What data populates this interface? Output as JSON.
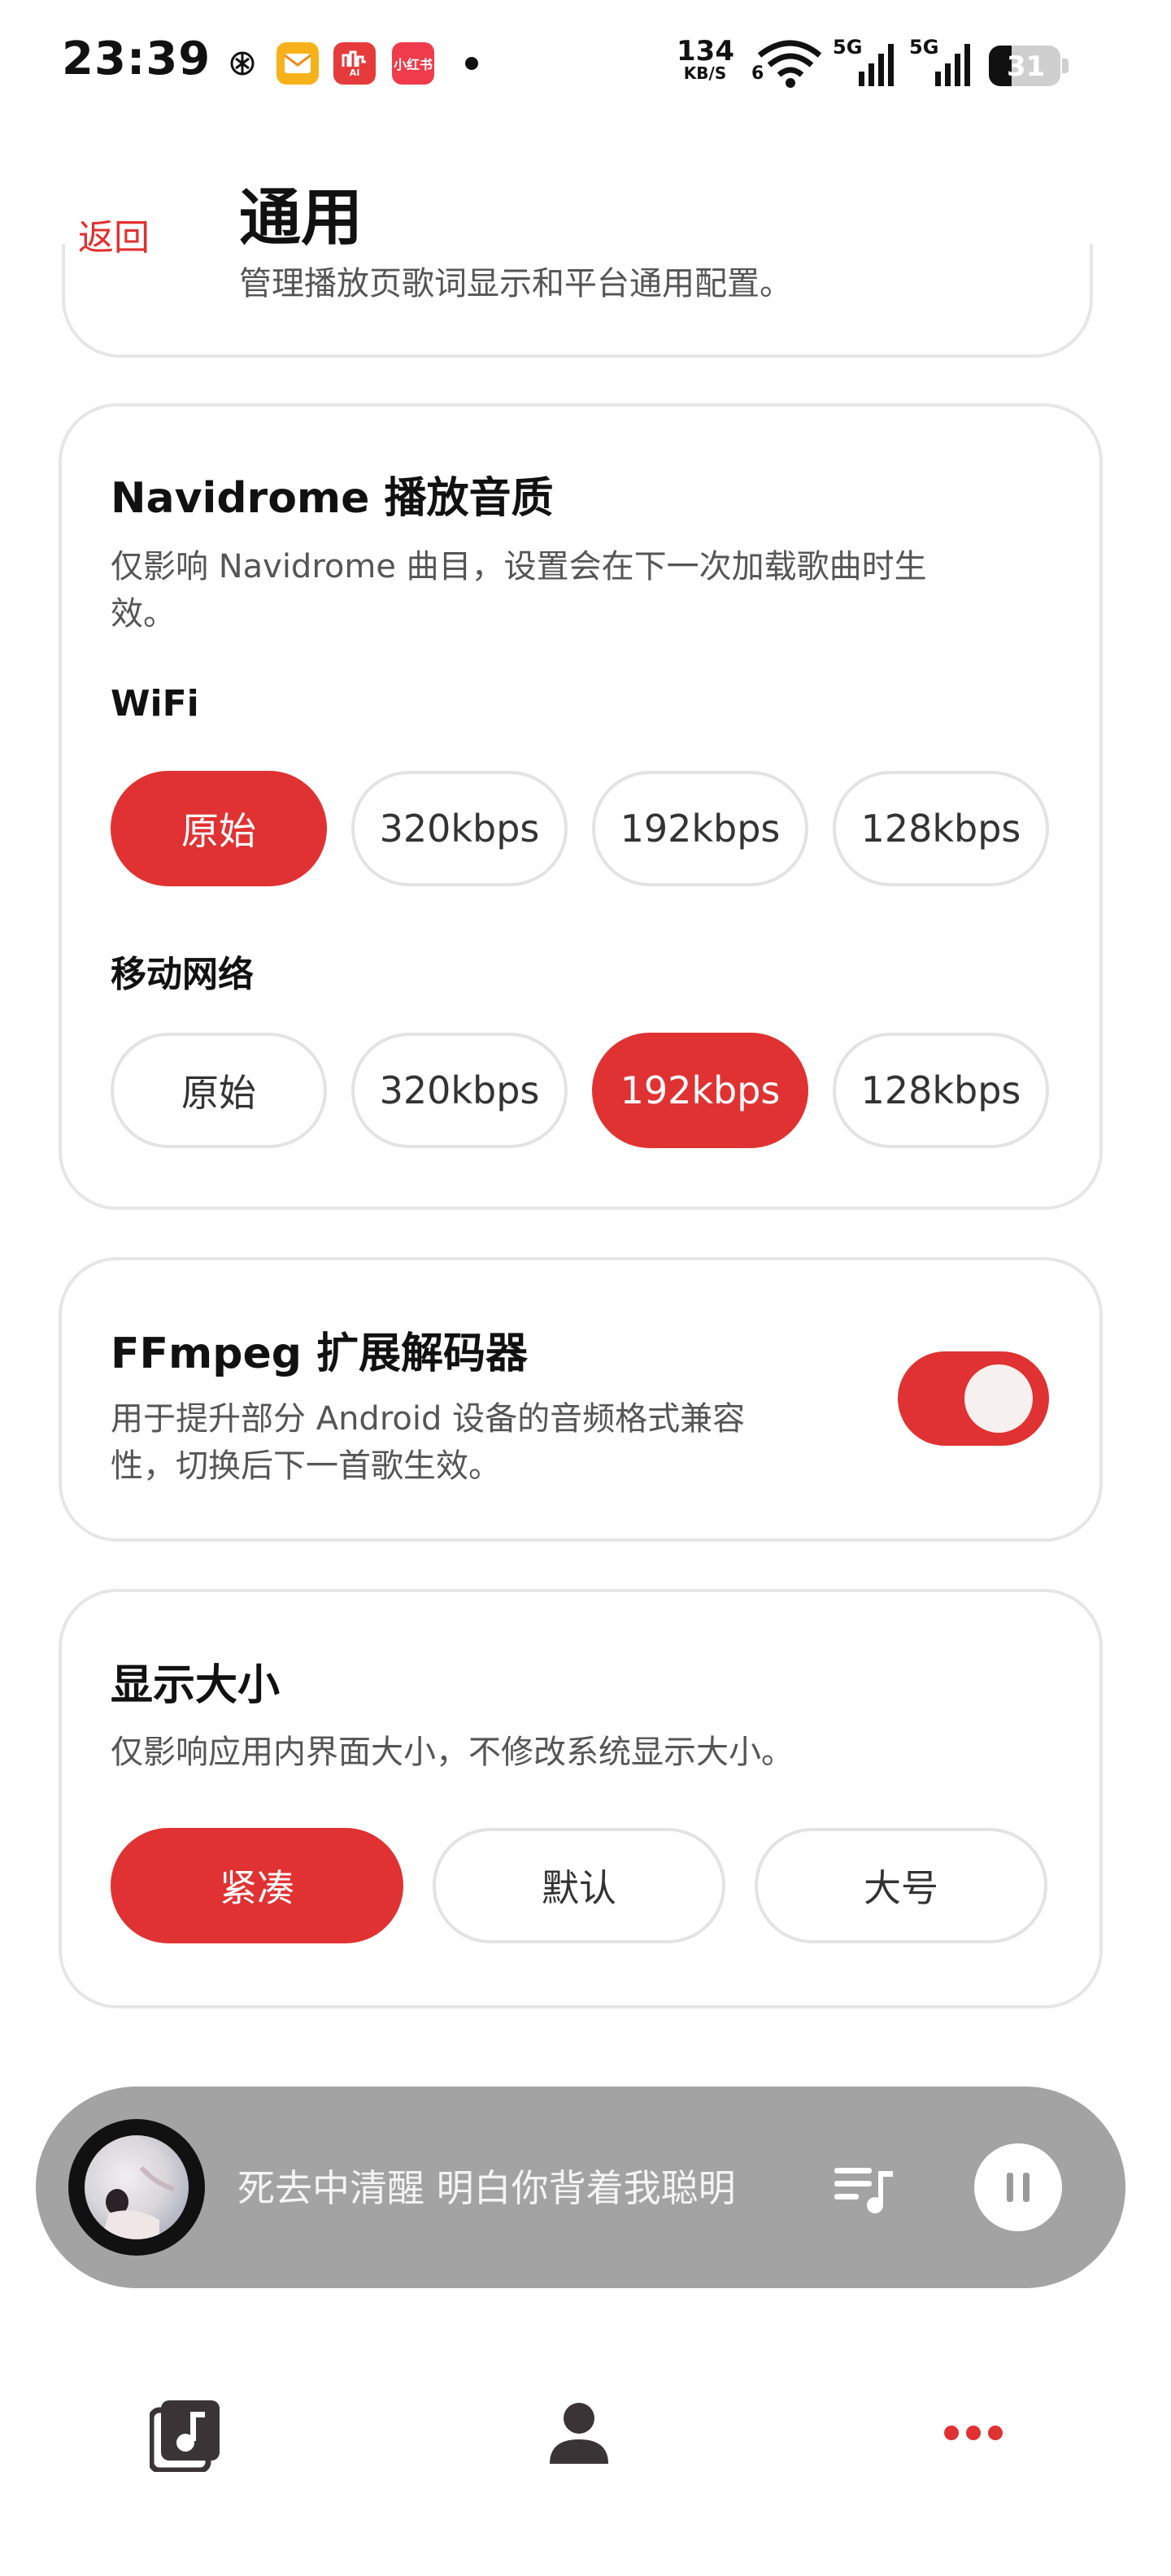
{
  "status_bar": {
    "time": "23:39",
    "app_icons": [
      "chatgpt-icon",
      "mail-app-icon",
      "ai-app-icon",
      "xiaohongshu-icon"
    ],
    "xiaohongshu_label": "小红书",
    "ai_label": "AI",
    "net_speed_value": "134",
    "net_speed_unit": "KB/S",
    "wifi_label": "6",
    "signal1_label": "5G",
    "signal2_label": "5G",
    "battery": "31",
    "colors": {
      "mail": "#f7b21b",
      "ai": "#e53b3b",
      "xhs": "#ef3b4a"
    }
  },
  "header": {
    "back_label": "返回",
    "title": "通用",
    "subtitle": "管理播放页歌词显示和平台通用配置。"
  },
  "quality": {
    "title": "Navidrome 播放音质",
    "description_line1": "仅影响 Navidrome 曲目，设置会在下一次加载歌曲时生",
    "description_line2": "效。",
    "wifi_label": "WiFi",
    "wifi_options": [
      "原始",
      "320kbps",
      "192kbps",
      "128kbps"
    ],
    "wifi_selected": "原始",
    "mobile_label": "移动网络",
    "mobile_options": [
      "原始",
      "320kbps",
      "192kbps",
      "128kbps"
    ],
    "mobile_selected": "192kbps"
  },
  "ffmpeg": {
    "title": "FFmpeg 扩展解码器",
    "description_line1": "用于提升部分 Android 设备的音频格式兼容",
    "description_line2": "性，切换后下一首歌生效。",
    "enabled": true
  },
  "display_size": {
    "title": "显示大小",
    "description": "仅影响应用内界面大小，不修改系统显示大小。",
    "options": [
      "紧凑",
      "默认",
      "大号"
    ],
    "selected": "紧凑"
  },
  "player": {
    "song_text": "死去中清醒 明白你背着我聪明",
    "playlist_icon": "playlist-icon",
    "pause_icon": "pause-icon"
  },
  "bottom_nav": {
    "items": [
      "music-library-icon",
      "profile-icon",
      "more-icon"
    ],
    "active": "more-icon"
  },
  "colors": {
    "accent": "#e03232",
    "player_bg": "#a3a3a3"
  }
}
